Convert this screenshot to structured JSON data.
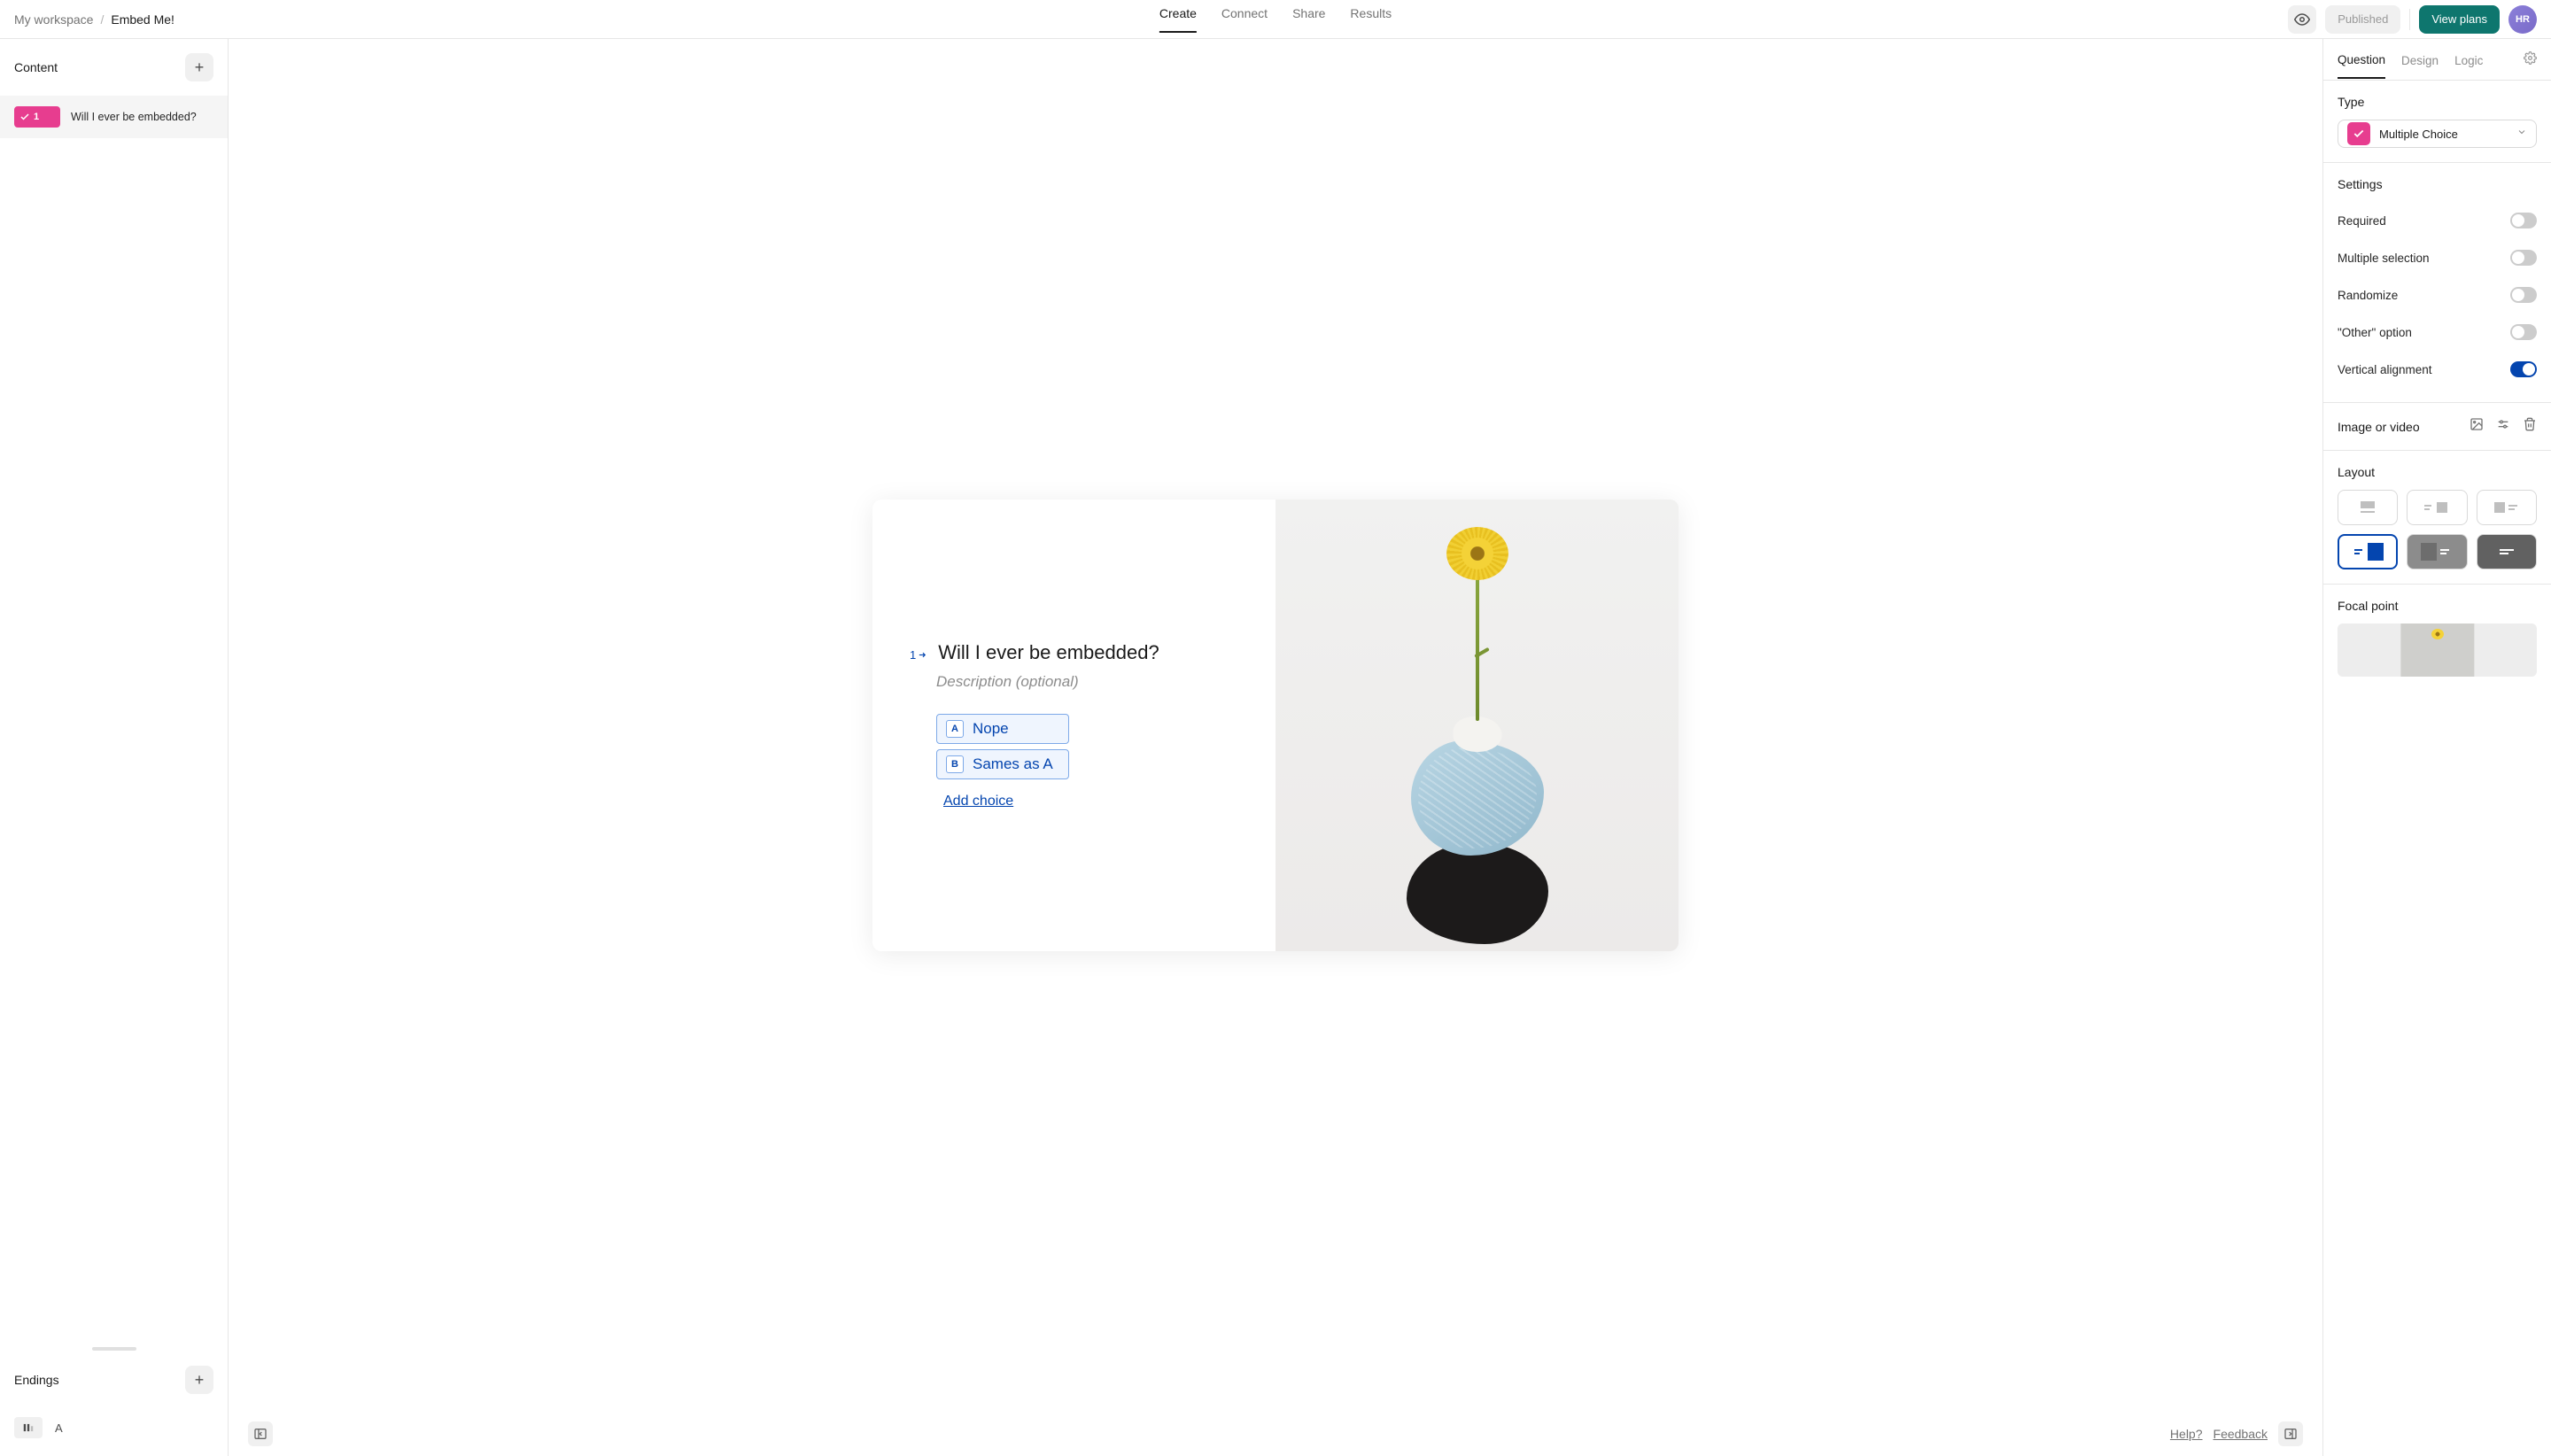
{
  "breadcrumb": {
    "workspace": "My workspace",
    "form": "Embed Me!"
  },
  "topnav": {
    "create": "Create",
    "connect": "Connect",
    "share": "Share",
    "results": "Results"
  },
  "topright": {
    "published": "Published",
    "plans": "View plans",
    "avatar": "HR"
  },
  "left": {
    "content": "Content",
    "endings": "Endings",
    "questions": [
      {
        "num": "1",
        "label": "Will I ever be embedded?"
      }
    ],
    "ending_letter": "A"
  },
  "card": {
    "q_num": "1",
    "title": "Will I ever be embedded?",
    "desc": "Description (optional)",
    "choices": [
      {
        "key": "A",
        "text": "Nope"
      },
      {
        "key": "B",
        "text": "Sames as A"
      }
    ],
    "add_choice": "Add choice"
  },
  "footer": {
    "help": "Help?",
    "feedback": "Feedback"
  },
  "right": {
    "tabs": {
      "question": "Question",
      "design": "Design",
      "logic": "Logic"
    },
    "type_label": "Type",
    "type_name": "Multiple Choice",
    "settings_label": "Settings",
    "settings": {
      "required": "Required",
      "multiple": "Multiple selection",
      "randomize": "Randomize",
      "other": "\"Other\" option",
      "vertical": "Vertical alignment"
    },
    "img_label": "Image or video",
    "layout_label": "Layout",
    "focal_label": "Focal point"
  }
}
